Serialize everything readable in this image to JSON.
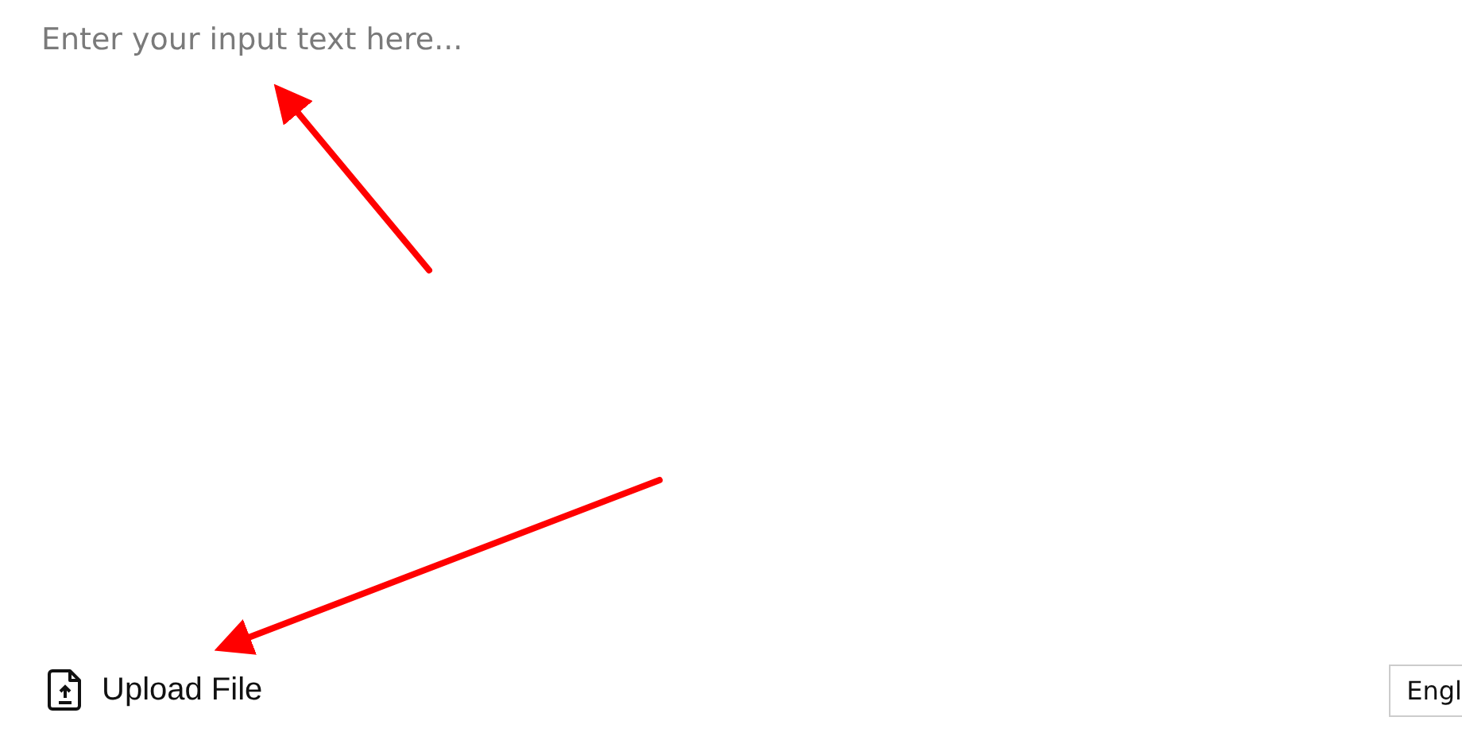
{
  "input": {
    "placeholder": "Enter your input text here..."
  },
  "upload": {
    "label": "Upload File"
  },
  "language": {
    "value": "Engl"
  },
  "annotations": [
    {
      "kind": "arrow"
    },
    {
      "kind": "arrow"
    }
  ]
}
